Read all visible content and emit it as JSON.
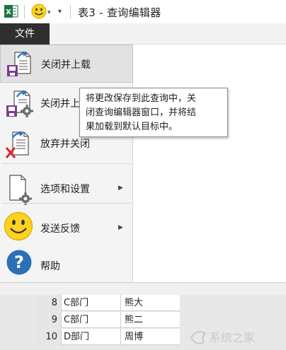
{
  "titlebar": {
    "title": "表3 - 查询编辑器",
    "excel_icon_letter": "X",
    "brand_color": "#217346"
  },
  "tabs": {
    "file": "文件"
  },
  "menu": {
    "items": [
      {
        "id": "close-load",
        "label": "关闭并上载",
        "icon": "close-load-icon"
      },
      {
        "id": "close-load-to",
        "label": "关闭并上",
        "icon": "close-load-to-icon"
      },
      {
        "id": "discard-close",
        "label": "放弃并关闭",
        "icon": "discard-close-icon"
      },
      {
        "id": "options-settings",
        "label": "选项和设置",
        "icon": "settings-icon",
        "has_submenu": true
      },
      {
        "id": "send-feedback",
        "label": "发送反馈",
        "icon": "smiley-icon",
        "has_submenu": true
      },
      {
        "id": "help",
        "label": "帮助",
        "icon": "help-icon"
      }
    ]
  },
  "tooltip": {
    "line1": "将更改保存到此查询中，关",
    "line2": "闭查询编辑器窗口，并将结",
    "line3": "果加载到默认目标中。"
  },
  "grid": {
    "rows": [
      {
        "num": "8",
        "dept": "C部门",
        "name": "熊大"
      },
      {
        "num": "9",
        "dept": "C部门",
        "name": "熊二"
      },
      {
        "num": "10",
        "dept": "D部门",
        "name": "周博"
      }
    ]
  },
  "watermark": {
    "text": "系统之家"
  }
}
